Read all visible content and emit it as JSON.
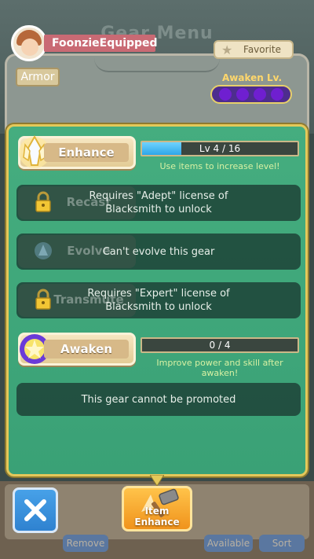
{
  "header": {
    "title": "Gear Menu",
    "player_name": "FoonzieEquipped",
    "favorite_label": "Favorite",
    "category_tag": "Armor",
    "awaken_label": "Awaken Lv.",
    "awaken_slots_total": 4
  },
  "panel": {
    "enhance": {
      "label": "Enhance",
      "level_text": "Lv 4 / 16",
      "level_current": 4,
      "level_max": 16,
      "hint": "Use items to increase level!"
    },
    "recast": {
      "label": "Recast",
      "message": "Requires \"Adept\" license of Blacksmith to unlock"
    },
    "evolve": {
      "label": "Evolve",
      "message": "Can't evolve this gear"
    },
    "transmute": {
      "label": "Transmute",
      "message": "Requires \"Expert\" license of Blacksmith to unlock"
    },
    "awaken": {
      "label": "Awaken",
      "progress_text": "0 / 4",
      "progress_current": 0,
      "progress_max": 4,
      "hint": "Improve power and skill after awaken!"
    },
    "promote_message": "This gear cannot be promoted"
  },
  "footer": {
    "item_enhance_label": "Item Enhance",
    "tab_remove": "Remove",
    "tab_available": "Available",
    "tab_sort": "Sort"
  },
  "colors": {
    "panel_green": "#3fa77b",
    "panel_border": "#e4c85a",
    "progress_blue": "#2ea6e8",
    "awaken_purple": "#6f1fd0"
  }
}
